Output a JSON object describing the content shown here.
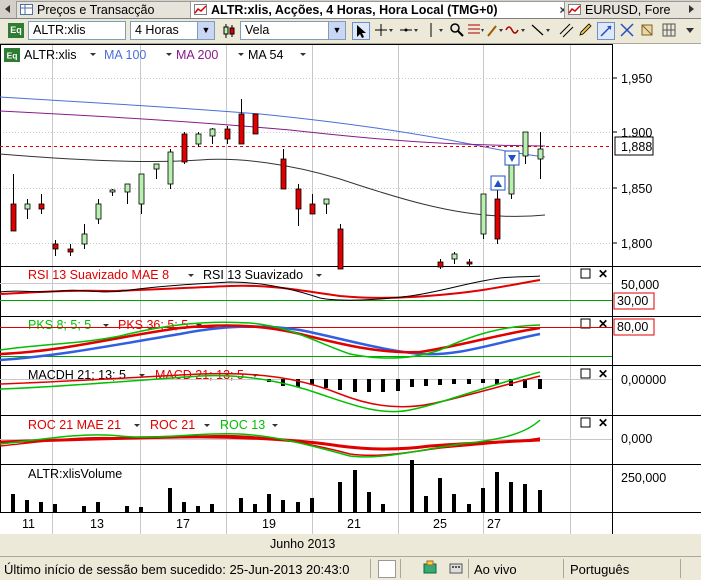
{
  "tabs": [
    {
      "label": "Preços e Transacção",
      "active": false
    },
    {
      "label": "ALTR:xlis, Acções, 4 Horas, Hora Local (TMG+0)",
      "active": true
    },
    {
      "label": "EURUSD, Fore",
      "active": false
    }
  ],
  "tabs_close": "×",
  "toolbar": {
    "symbol": "ALTR:xlis",
    "symbol_badge": "Eq",
    "interval": "4 Horas",
    "chart_type": "Vela"
  },
  "main_panel": {
    "symbol_label": "ALTR:xlis",
    "symbol_badge": "Eq",
    "legend": [
      {
        "name": "MA 100",
        "color": "#4a6fd8"
      },
      {
        "name": "MA 200",
        "color": "#8a1a8a"
      },
      {
        "name": "MA 54",
        "color": "#000000"
      }
    ],
    "y_ticks": [
      "1,950",
      "1,900",
      "1,850",
      "1,800"
    ],
    "last_price": "1,888"
  },
  "rsi_panel": {
    "legend": [
      {
        "name": "RSI 13 Suavizado MAE 8",
        "color": "#e00000"
      },
      {
        "name": "RSI 13 Suavizado",
        "color": "#000000"
      }
    ],
    "level_50": "50,000",
    "level_30": "30,00"
  },
  "pks_panel": {
    "legend": [
      {
        "name": "PKS 8; 5; 5",
        "color": "#00c000"
      },
      {
        "name": "PKS 36; 5; 5",
        "color": "#e00000"
      }
    ],
    "level_80": "80,00"
  },
  "macd_panel": {
    "legend": [
      {
        "name": "MACDH 21; 13; 5",
        "color": "#000000"
      },
      {
        "name": "MACD 21; 13; 5",
        "color": "#e00000"
      }
    ],
    "zero": "0,00000"
  },
  "roc_panel": {
    "legend": [
      {
        "name": "ROC 21 MAE 21",
        "color": "#e00000"
      },
      {
        "name": "ROC 21",
        "color": "#e00000"
      },
      {
        "name": "ROC 13",
        "color": "#00c000"
      }
    ],
    "zero": "0,000"
  },
  "volume_panel": {
    "title": "ALTR:xlisVolume",
    "level": "250,000"
  },
  "x_axis": {
    "days": [
      "11",
      "13",
      "17",
      "19",
      "21",
      "25",
      "27"
    ],
    "month": "Junho 2013"
  },
  "status": {
    "message": "Último início de sessão bem sucedido: 25-Jun-2013 20:43:0",
    "live": "Ao vivo",
    "language": "Português"
  },
  "colors": {
    "up_candle": "#b8f0b0",
    "down_candle": "#e00000",
    "grid": "#c8c8c8",
    "price_line": "#e00000"
  }
}
